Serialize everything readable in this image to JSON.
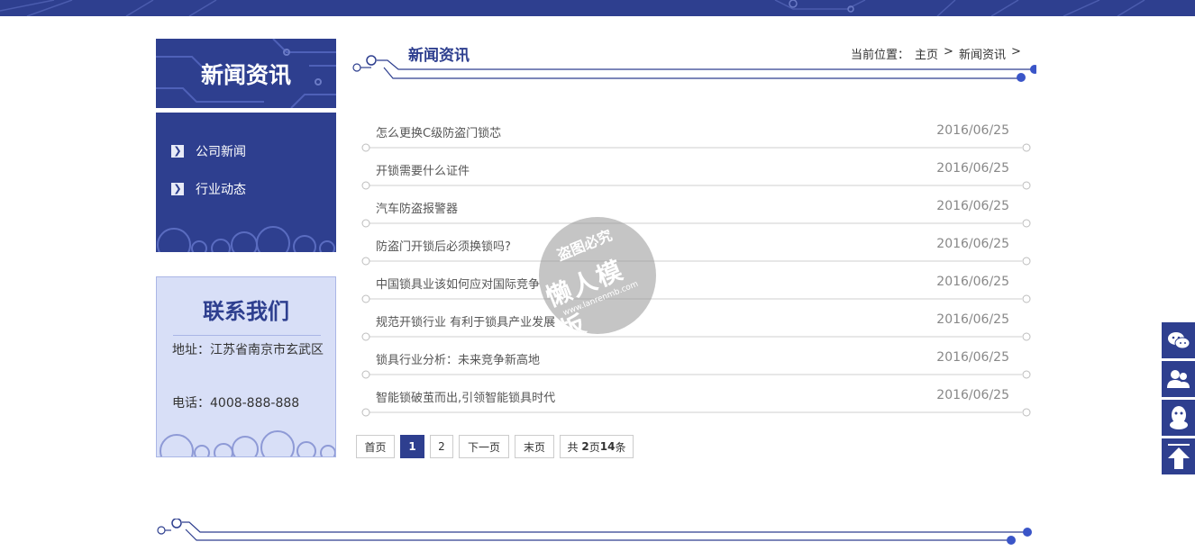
{
  "side": {
    "title": "新闻资讯",
    "menu": [
      {
        "label": "公司新闻",
        "icon": "chevron-right-icon"
      },
      {
        "label": "行业动态",
        "icon": "chevron-right-icon"
      }
    ]
  },
  "contact": {
    "title": "联系我们",
    "address": "地址：江苏省南京市玄武区",
    "phone": "电话：4008-888-888"
  },
  "main": {
    "heading": "新闻资讯",
    "breadcrumb": {
      "label": "当前位置：",
      "home": "主页",
      "sep1": ">",
      "current": "新闻资讯",
      "sep2": ">"
    }
  },
  "news": [
    {
      "title": "怎么更换C级防盗门锁芯",
      "date": "2016/06/25"
    },
    {
      "title": "开锁需要什么证件",
      "date": "2016/06/25"
    },
    {
      "title": "汽车防盗报警器",
      "date": "2016/06/25"
    },
    {
      "title": "防盗门开锁后必须换锁吗?",
      "date": "2016/06/25"
    },
    {
      "title": "中国锁具业该如何应对国际竞争",
      "date": "2016/06/25"
    },
    {
      "title": "规范开锁行业 有利于锁具产业发展",
      "date": "2016/06/25"
    },
    {
      "title": "锁具行业分析：未来竞争新高地",
      "date": "2016/06/25"
    },
    {
      "title": "智能锁破茧而出,引领智能锁具时代",
      "date": "2016/06/25"
    }
  ],
  "pager": {
    "first": "首页",
    "p1": "1",
    "p2": "2",
    "next": "下一页",
    "last": "末页",
    "info_prefix": "共",
    "info_pages": "2",
    "info_mid": "页",
    "info_count": "14",
    "info_suffix": "条"
  },
  "floating": [
    {
      "icon": "wechat-icon"
    },
    {
      "icon": "users-icon"
    },
    {
      "icon": "qq-icon"
    },
    {
      "icon": "arrow-up-icon"
    }
  ],
  "watermark": {
    "line1": "盗图必究",
    "line2": "懒人模板",
    "line3": "www.lanrenmb.com"
  },
  "colors": {
    "brand": "#2e3f8f",
    "light": "#d8dff7"
  }
}
